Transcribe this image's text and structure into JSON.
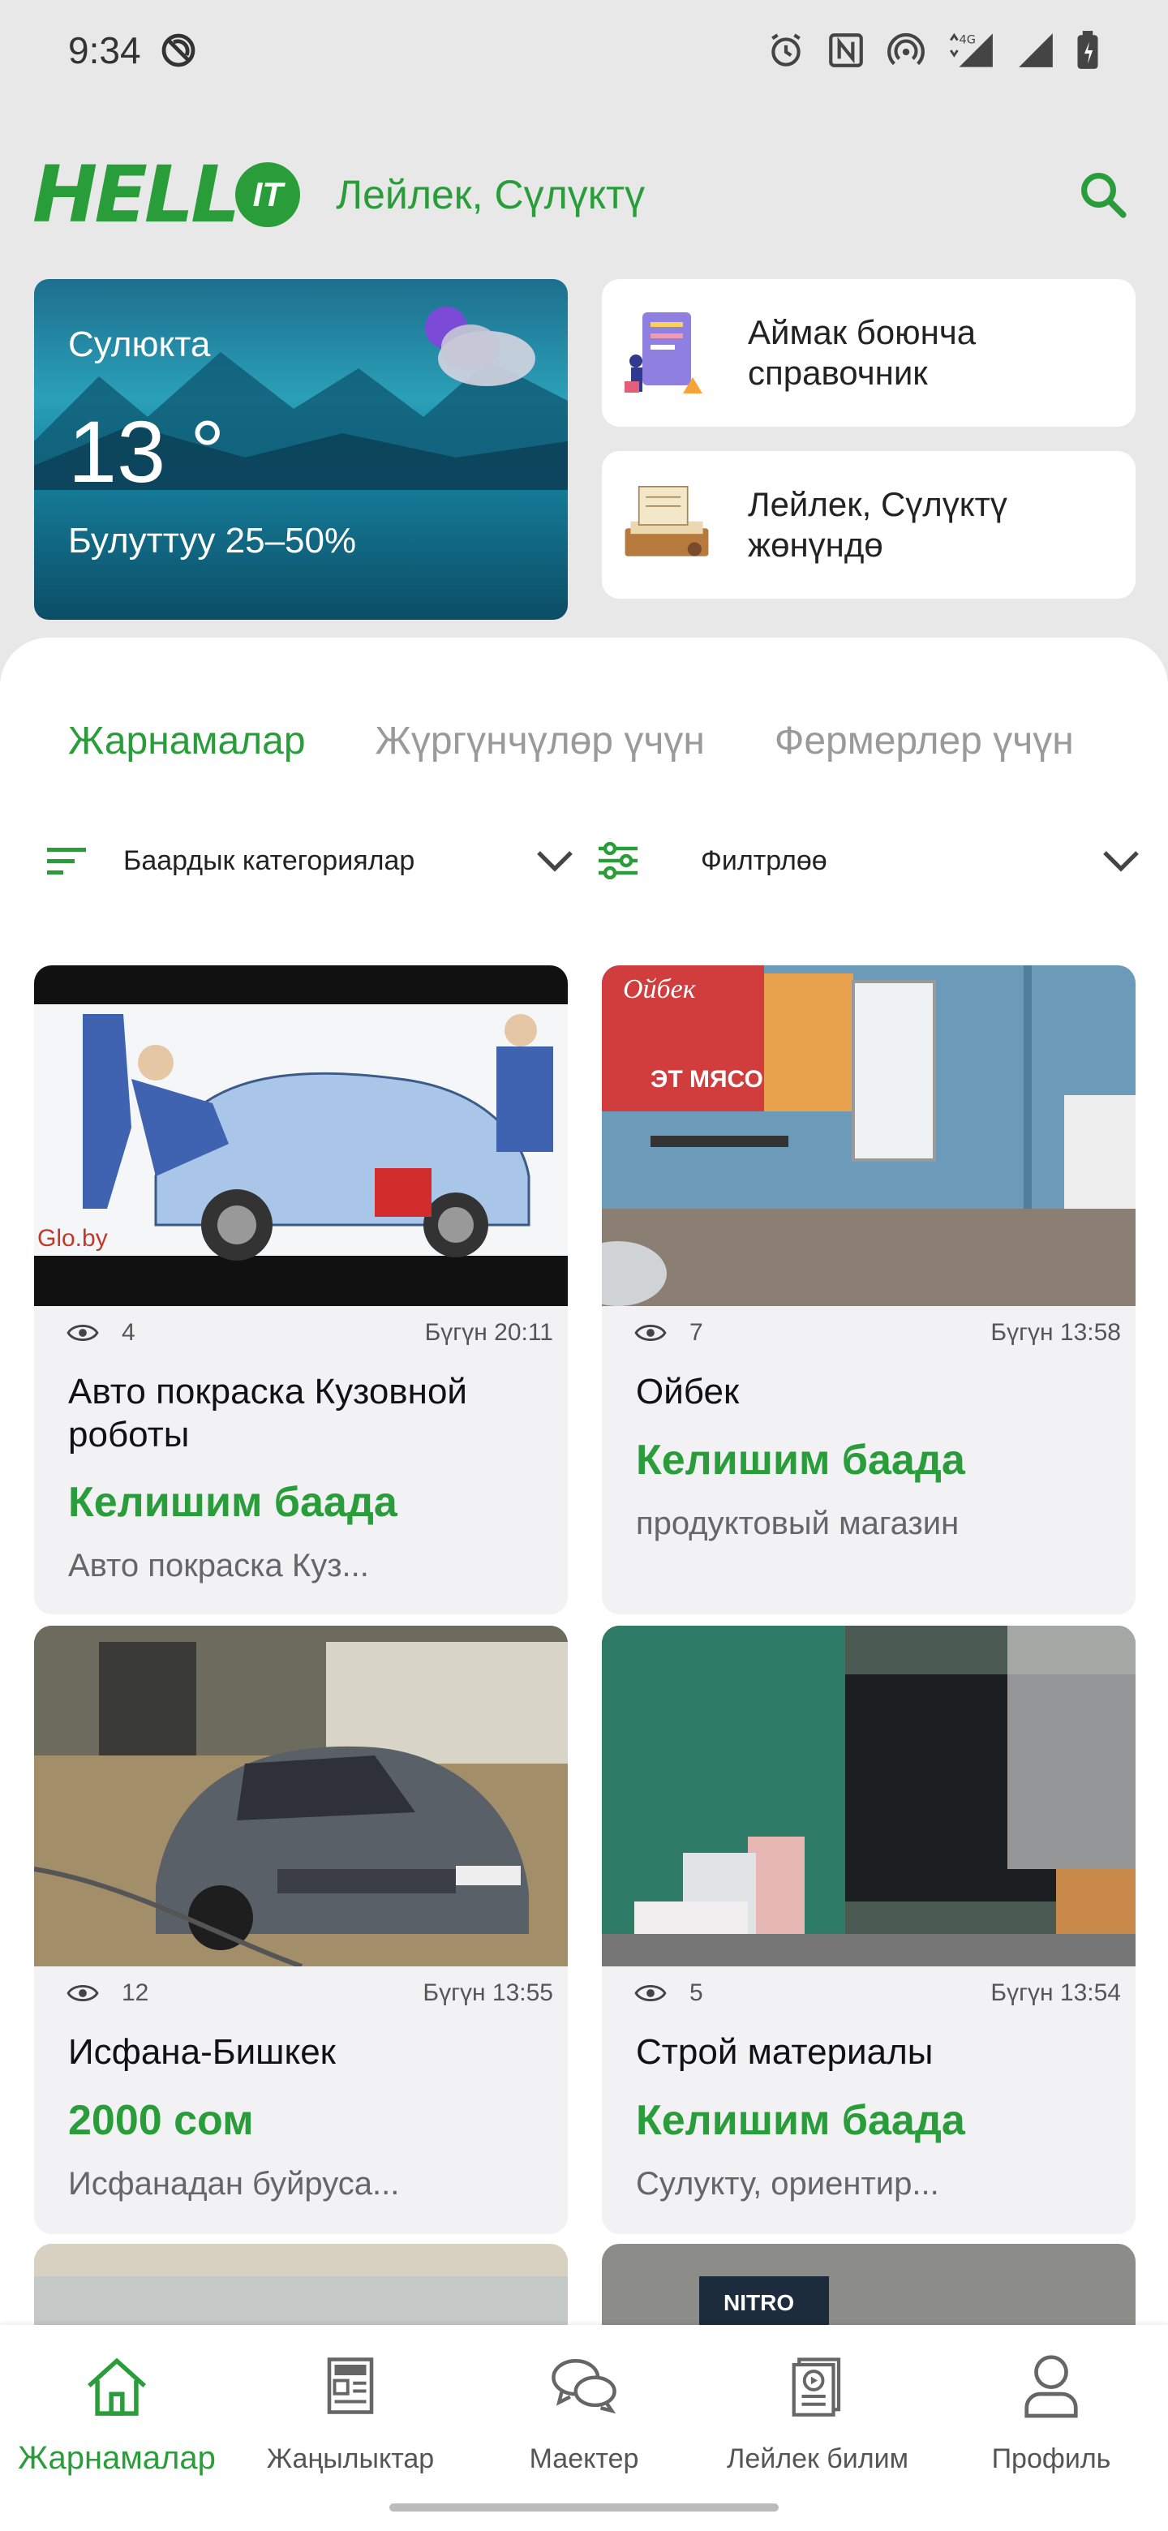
{
  "status_bar": {
    "time": "9:34",
    "network": "4G"
  },
  "header": {
    "logo_text": "HELL",
    "logo_badge": "IT",
    "location": "Лейлек, Сүлүктү"
  },
  "weather": {
    "city": "Сулюкта",
    "temperature": "13 °",
    "condition": "Булуттуу 25–50%"
  },
  "info_cards": [
    {
      "label": "Аймак боюнча\nсправочник"
    },
    {
      "label": "Лейлек, Сүлүктү\nжөнүндө"
    }
  ],
  "tabs": [
    {
      "label": "Жарнамалар",
      "active": true
    },
    {
      "label": "Жүргүнчүлөр үчүн",
      "active": false
    },
    {
      "label": "Фермерлер үчүн",
      "active": false
    }
  ],
  "filters": {
    "category_label": "Баардык категориялар",
    "filter_label": "Филтрлөө"
  },
  "listings": [
    {
      "views": "4",
      "date": "Бүгүн 20:11",
      "title": "Авто покраска Кузовной роботы",
      "price": "Келишим баада",
      "desc": "Авто покраска Куз..."
    },
    {
      "views": "7",
      "date": "Бүгүн 13:58",
      "title": "Ойбек",
      "price": "Келишим баада",
      "desc": "продуктовый магазин"
    },
    {
      "views": "12",
      "date": "Бүгүн 13:55",
      "title": "Исфана-Бишкек",
      "price": "2000 сом",
      "desc": "Исфанадан буйруса..."
    },
    {
      "views": "5",
      "date": "Бүгүн 13:54",
      "title": "Строй материалы",
      "price": "Келишим баада",
      "desc": "Сулукту, ориентир..."
    }
  ],
  "image_texts": {
    "watermark": "Glo.by",
    "shop_sign": "Ойбек",
    "shop_sign2": "ЭТ МЯСО",
    "brand_sign": "NITRO"
  },
  "bottom_nav": [
    {
      "label": "Жарнамалар",
      "icon": "home-icon",
      "active": true
    },
    {
      "label": "Жаңылыктар",
      "icon": "news-icon",
      "active": false
    },
    {
      "label": "Маектер",
      "icon": "chat-icon",
      "active": false
    },
    {
      "label": "Лейлек билим",
      "icon": "education-icon",
      "active": false
    },
    {
      "label": "Профиль",
      "icon": "profile-icon",
      "active": false
    }
  ],
  "colors": {
    "accent": "#2a9d3b",
    "background": "#e8e8e8",
    "card": "#f2f2f4"
  }
}
